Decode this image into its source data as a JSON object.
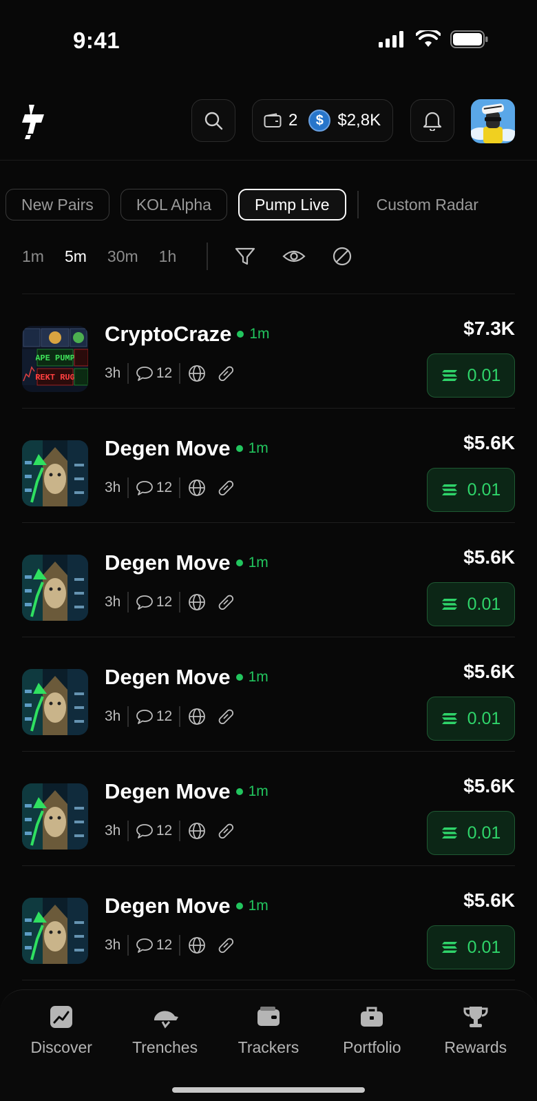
{
  "status": {
    "time": "9:41"
  },
  "wallet": {
    "count": "2",
    "balance": "$2,8K",
    "token_symbol": "$"
  },
  "tabs": [
    {
      "label": "New Pairs",
      "active": false
    },
    {
      "label": "KOL Alpha",
      "active": false
    },
    {
      "label": "Pump Live",
      "active": true
    },
    {
      "label": "Custom Radar",
      "active": false
    }
  ],
  "timeframes": [
    {
      "label": "1m",
      "active": false
    },
    {
      "label": "5m",
      "active": true
    },
    {
      "label": "30m",
      "active": false
    },
    {
      "label": "1h",
      "active": false
    }
  ],
  "tokens": [
    {
      "name": "CryptoCraze",
      "age": "1m",
      "created": "3h",
      "comments": "12",
      "mcap": "$7.3K",
      "buy_amount": "0.01",
      "thumb": "cryptocraze-thumb"
    },
    {
      "name": "Degen Move",
      "age": "1m",
      "created": "3h",
      "comments": "12",
      "mcap": "$5.6K",
      "buy_amount": "0.01",
      "thumb": "degen-cat-thumb"
    },
    {
      "name": "Degen Move",
      "age": "1m",
      "created": "3h",
      "comments": "12",
      "mcap": "$5.6K",
      "buy_amount": "0.01",
      "thumb": "degen-cat-thumb"
    },
    {
      "name": "Degen Move",
      "age": "1m",
      "created": "3h",
      "comments": "12",
      "mcap": "$5.6K",
      "buy_amount": "0.01",
      "thumb": "degen-cat-thumb"
    },
    {
      "name": "Degen Move",
      "age": "1m",
      "created": "3h",
      "comments": "12",
      "mcap": "$5.6K",
      "buy_amount": "0.01",
      "thumb": "degen-cat-thumb"
    },
    {
      "name": "Degen Move",
      "age": "1m",
      "created": "3h",
      "comments": "12",
      "mcap": "$5.6K",
      "buy_amount": "0.01",
      "thumb": "degen-cat-thumb"
    }
  ],
  "thumb_text": {
    "cryptocraze": [
      "APE PUMP",
      "REKT RUG"
    ]
  },
  "nav": [
    {
      "label": "Discover",
      "icon": "chart-icon"
    },
    {
      "label": "Trenches",
      "icon": "helmet-icon"
    },
    {
      "label": "Trackers",
      "icon": "wallet-icon"
    },
    {
      "label": "Portfolio",
      "icon": "briefcase-icon"
    },
    {
      "label": "Rewards",
      "icon": "trophy-icon"
    }
  ],
  "colors": {
    "accent_green": "#22c55e",
    "buy_bg": "#0c2616",
    "usdc_blue": "#2775ca",
    "background": "#080808"
  }
}
